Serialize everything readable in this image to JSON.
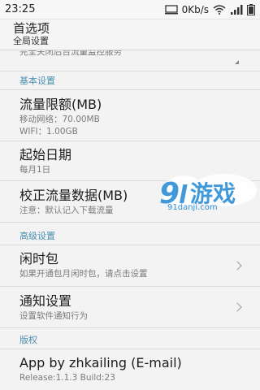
{
  "status_bar": {
    "time": "23:25",
    "speed": "0Kb/s",
    "icons": [
      "notification-icon",
      "wifi-icon",
      "signal-icon",
      "battery-icon"
    ]
  },
  "header": {
    "title": "首选项",
    "subtitle": "全局设置"
  },
  "partial_item": {
    "text": "完全关闭后台流量监控服务"
  },
  "sections": {
    "basic": "基本设置",
    "advanced": "高级设置",
    "copyright": "版权"
  },
  "items": {
    "traffic_limit": {
      "title": "流量限额(MB)",
      "line1": "移动网络：70.00MB",
      "line2": "WIFI：1.00GB"
    },
    "start_date": {
      "title": "起始日期",
      "sub": "每月1日"
    },
    "calibrate": {
      "title": "校正流量数据(MB)",
      "sub": "注意：默认记入下载流量"
    },
    "idle_pack": {
      "title": "闲时包",
      "sub": "如果开通包月闲时包，请点击设置"
    },
    "notify": {
      "title": "通知设置",
      "sub": "设置软件通知行为"
    },
    "about": {
      "title": "App by zhkailing (E-mail)",
      "sub": "Release:1.1.3 Build:23"
    }
  },
  "watermark": {
    "logo_text": "91游戏",
    "site": "91danji.com"
  },
  "colors": {
    "section_header": "#4a8fb0",
    "background": "#f3f3f3",
    "watermark": "#2e8fd6"
  }
}
